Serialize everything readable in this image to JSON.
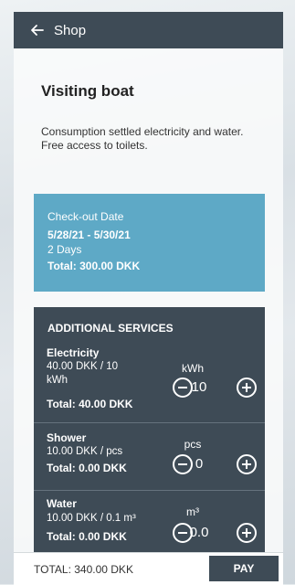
{
  "header": {
    "title": "Shop",
    "back_icon": "arrow-left-icon"
  },
  "page": {
    "heading": "Visiting boat",
    "description_lines": [
      "Consumption settled electricity and water.",
      "Free access to toilets."
    ]
  },
  "checkout": {
    "label": "Check-out Date",
    "dates": "5/28/21 - 5/30/21",
    "days": "2 Days",
    "total": "Total: 300.00 DKK"
  },
  "services": {
    "title": "ADDITIONAL SERVICES",
    "items": [
      {
        "name": "Electricity",
        "price": "40.00 DKK / 10 kWh",
        "total": "Total: 40.00 DKK",
        "unit": "kWh",
        "quantity": "10"
      },
      {
        "name": "Shower",
        "price": "10.00 DKK / pcs",
        "total": "Total: 0.00 DKK",
        "unit": "pcs",
        "quantity": "0"
      },
      {
        "name": "Water",
        "price": "10.00 DKK / 0.1 m³",
        "total": "Total: 0.00 DKK",
        "unit": "m³",
        "quantity": "0.0"
      }
    ]
  },
  "footer": {
    "total": "TOTAL: 340.00 DKK",
    "pay_label": "PAY"
  },
  "colors": {
    "header_bg": "#3e4b56",
    "checkout_bg": "#5ea9c6",
    "services_bg": "#3e4b56"
  }
}
